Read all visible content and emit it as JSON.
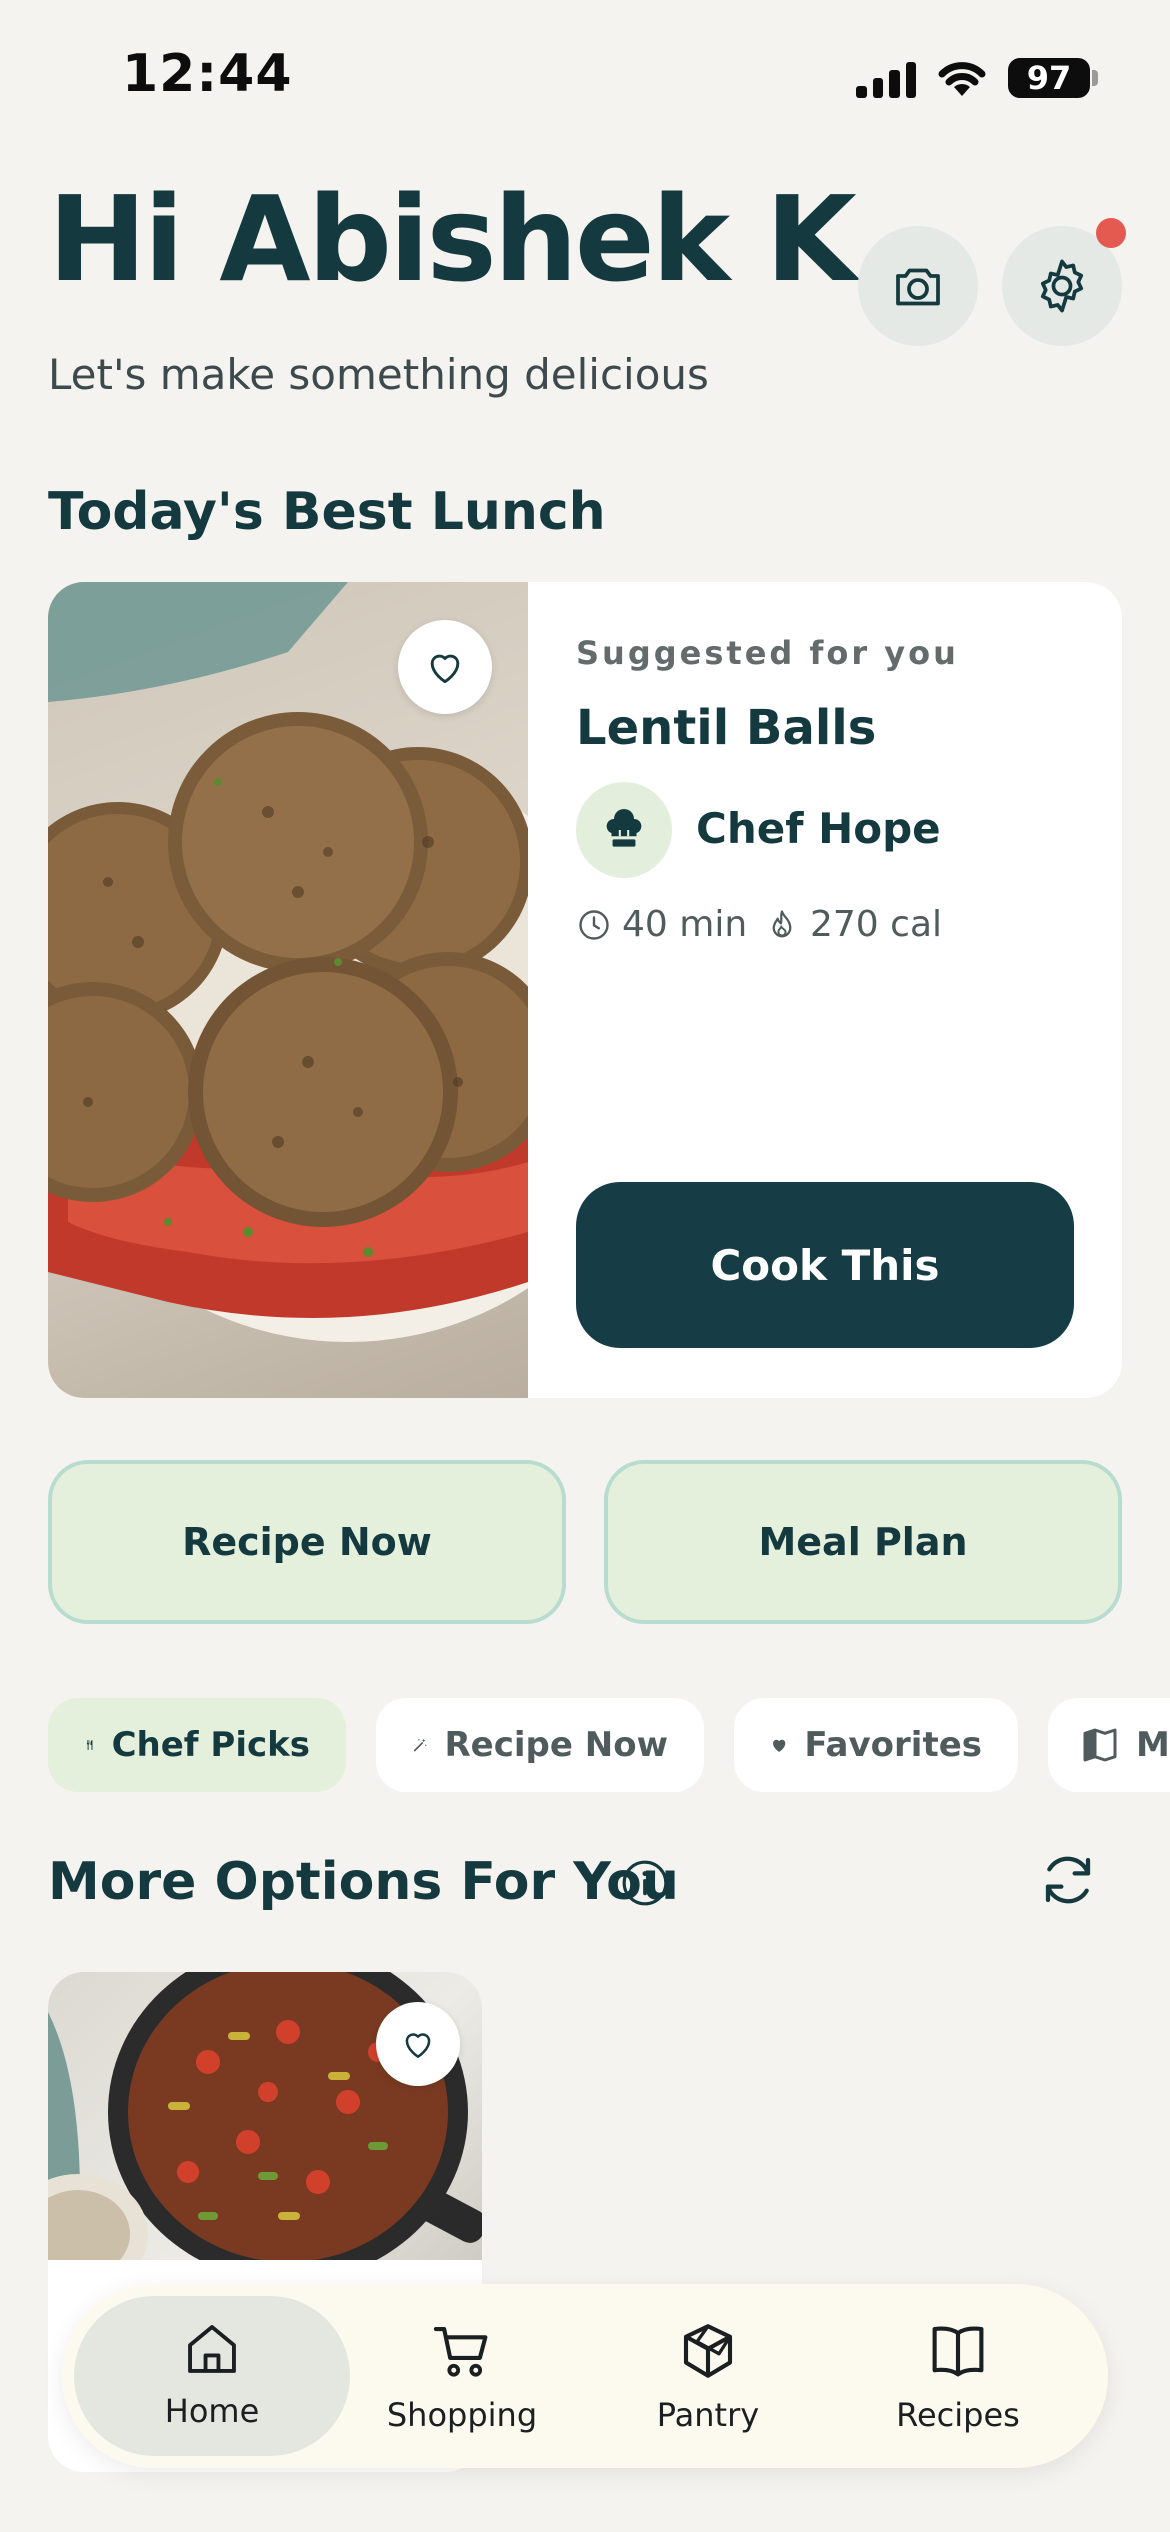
{
  "status_bar": {
    "time": "12:44",
    "battery": "97"
  },
  "header": {
    "greeting": "Hi Abishek K.",
    "subtitle": "Let's make something delicious"
  },
  "section_today": "Today's Best Lunch",
  "featured": {
    "eyebrow": "Suggested for you",
    "title": "Lentil Balls",
    "chef": "Chef Hope",
    "time": "40 min",
    "calories": "270 cal",
    "cta": "Cook This",
    "favorited": false
  },
  "quick_actions": [
    "Recipe Now",
    "Meal Plan"
  ],
  "chips": [
    {
      "label": "Chef Picks",
      "icon": "utensils-icon",
      "active": true
    },
    {
      "label": "Recipe Now",
      "icon": "magic-wand-icon",
      "active": false
    },
    {
      "label": "Favorites",
      "icon": "heart-icon",
      "active": false
    },
    {
      "label": "M",
      "icon": "map-icon",
      "active": false
    }
  ],
  "section_more": "More Options For You",
  "nav": {
    "active": "Home",
    "items": [
      {
        "label": "Home",
        "icon": "home-icon"
      },
      {
        "label": "Shopping",
        "icon": "cart-icon"
      },
      {
        "label": "Pantry",
        "icon": "box-icon"
      },
      {
        "label": "Recipes",
        "icon": "book-icon"
      }
    ]
  },
  "colors": {
    "primary": "#163d45",
    "background": "#f5f3ef",
    "mint": "#e4f0dc",
    "mint_border": "#b8dccf",
    "notification": "#e55a50"
  }
}
